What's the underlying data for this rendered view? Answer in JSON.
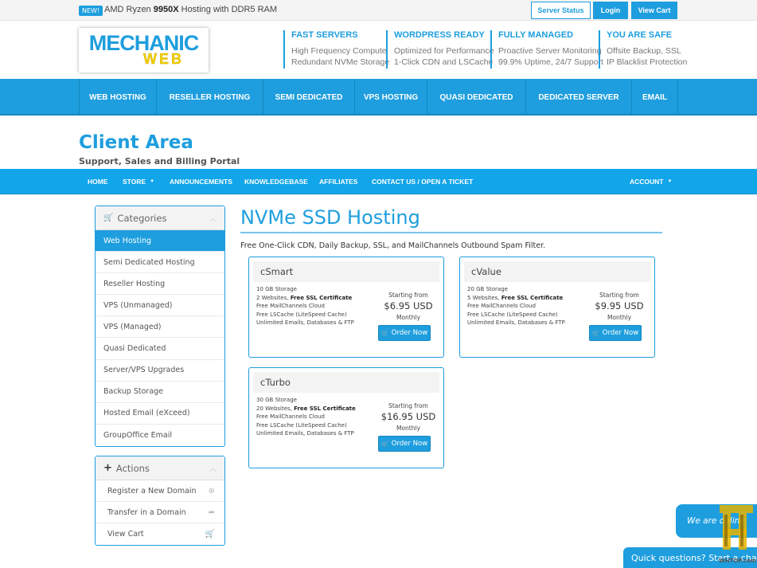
{
  "topbar": {
    "badge": "NEW!",
    "promo_pre": "AMD Ryzen",
    "promo_bold": "9950X",
    "promo_post": "Hosting with DDR5 RAM",
    "buttons": [
      "Server Status",
      "Login",
      "View Cart"
    ]
  },
  "logo": {
    "top": "MECHANIC",
    "bottom": "WEB"
  },
  "features": [
    {
      "title": "FAST SERVERS",
      "lines": [
        "High Frequency Compute",
        "Redundant NVMe Storage"
      ]
    },
    {
      "title": "WORDPRESS READY",
      "lines": [
        "Optimized for Performance",
        "1-Click CDN and LSCache"
      ]
    },
    {
      "title": "FULLY MANAGED",
      "lines": [
        "Proactive Server Monitoring",
        "99.9% Uptime, 24/7 Support"
      ]
    },
    {
      "title": "YOU ARE SAFE",
      "lines": [
        "Offsite Backup, SSL",
        "IP Blacklist Protection"
      ]
    }
  ],
  "main_nav": [
    "WEB HOSTING",
    "RESELLER HOSTING",
    "SEMI DEDICATED",
    "VPS HOSTING",
    "QUASI DEDICATED",
    "DEDICATED SERVER",
    "EMAIL"
  ],
  "client": {
    "title": "Client Area",
    "subtitle": "Support, Sales and Billing Portal"
  },
  "sub_nav": [
    "HOME",
    "STORE",
    "ANNOUNCEMENTS",
    "KNOWLEDGEBASE",
    "AFFILIATES",
    "CONTACT US / OPEN A TICKET",
    "ACCOUNT"
  ],
  "categories": {
    "title": "Categories",
    "items": [
      "Web Hosting",
      "Semi Dedicated Hosting",
      "Reseller Hosting",
      "VPS (Unmanaged)",
      "VPS (Managed)",
      "Quasi Dedicated",
      "Server/VPS Upgrades",
      "Backup Storage",
      "Hosted Email (eXceed)",
      "GroupOffice Email"
    ],
    "active": "Web Hosting"
  },
  "actions": {
    "title": "Actions",
    "items": [
      "Register a New Domain",
      "Transfer in a Domain",
      "View Cart"
    ]
  },
  "page": {
    "title": "NVMe SSD Hosting",
    "description": "Free One-Click CDN, Daily Backup, SSL, and MailChannels Outbound Spam Filter."
  },
  "products": [
    {
      "name": "cSmart",
      "features": [
        "10 GB Storage",
        "2 Websites, ",
        "Free MailChannels Cloud",
        "Free LSCache (LiteSpeed Cache)",
        "Unlimited Emails, Databases & FTP"
      ],
      "ssl": "Free SSL Certificate",
      "starting": "Starting from",
      "price": "$6.95 USD",
      "cycle": "Monthly",
      "button": "Order Now"
    },
    {
      "name": "cValue",
      "features": [
        "20 GB Storage",
        "5 Websites, ",
        "Free MailChannels Cloud",
        "Free LSCache (LiteSpeed Cache)",
        "Unlimited Emails, Databases & FTP"
      ],
      "ssl": "Free SSL Certificate",
      "starting": "Starting from",
      "price": "$9.95 USD",
      "cycle": "Monthly",
      "button": "Order Now"
    },
    {
      "name": "cTurbo",
      "features": [
        "30 GB Storage",
        "20 Websites, ",
        "Free MailChannels Cloud",
        "Free LSCache (LiteSpeed Cache)",
        "Unlimited Emails, Databases & FTP"
      ],
      "ssl": "Free SSL Certificate",
      "starting": "Starting from",
      "price": "$16.95 USD",
      "cycle": "Monthly",
      "button": "Order Now"
    }
  ],
  "chat": {
    "bubble": "We are online",
    "bar": "Quick questions? Start a chat"
  },
  "watermark": "WHTOP.com",
  "colors": {
    "accent": "#1e9ede",
    "subnav": "#11a5ea",
    "logo_yellow": "#f4d20b"
  }
}
